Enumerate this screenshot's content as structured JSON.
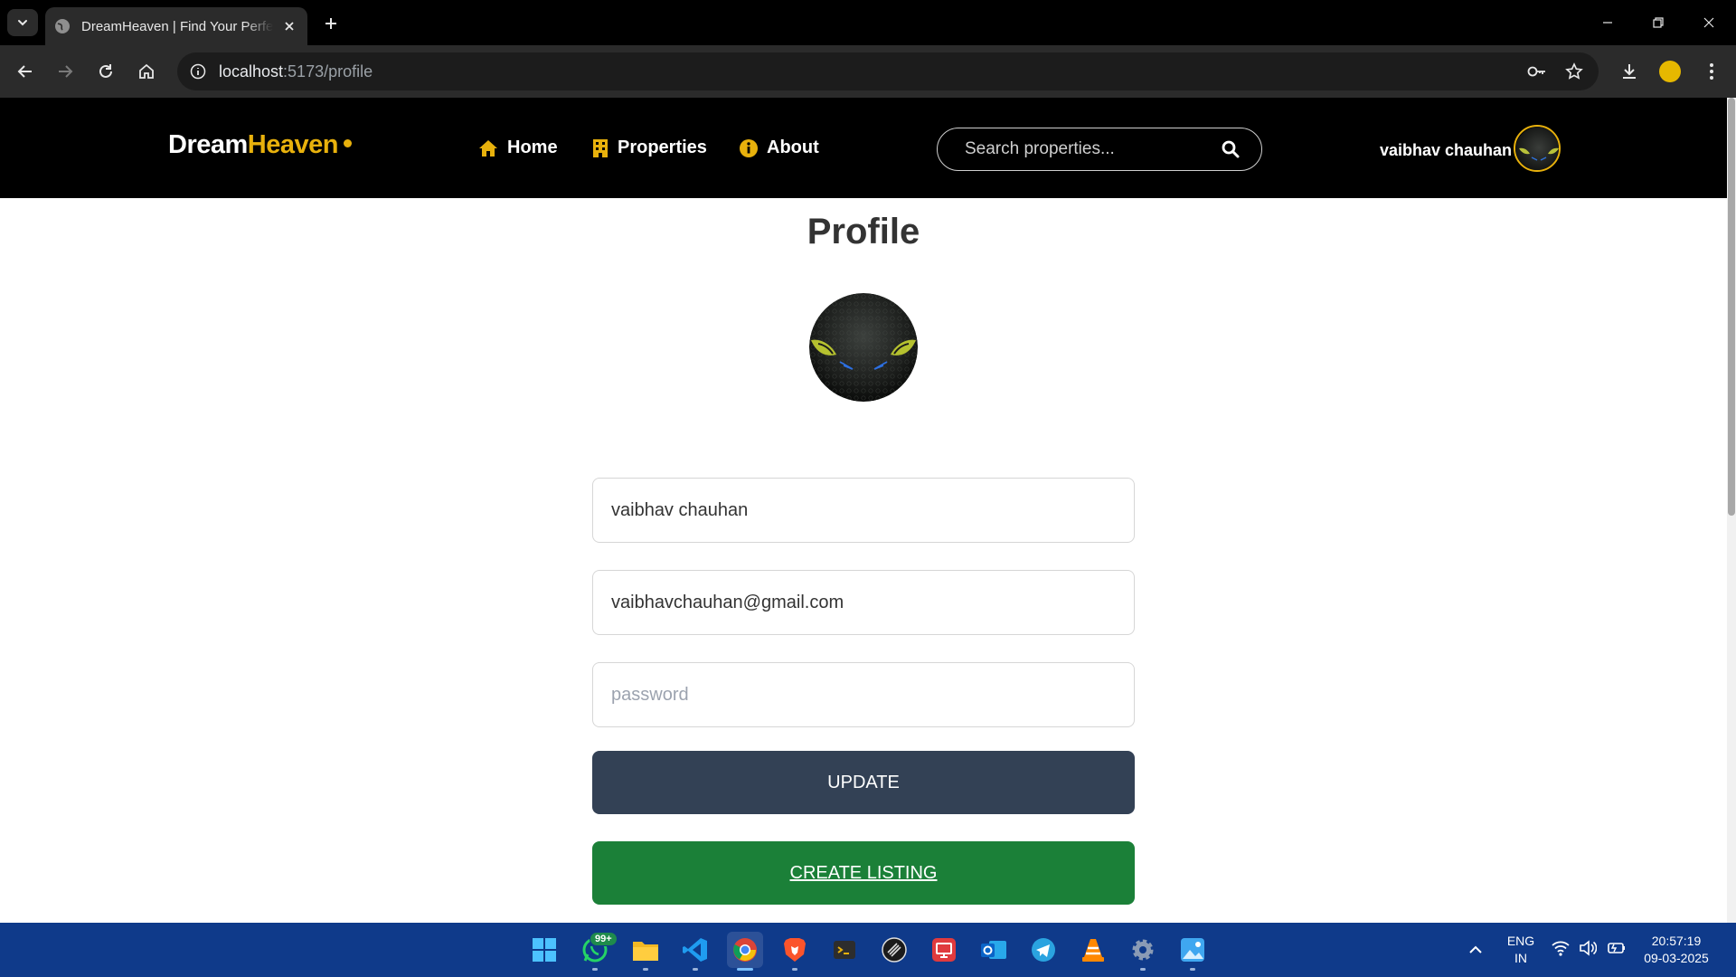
{
  "browser": {
    "tab_title": "DreamHeaven | Find Your Perfect",
    "url_host": "localhost",
    "url_path": ":5173/profile"
  },
  "site": {
    "logo_primary": "Dream",
    "logo_accent": "Heaven",
    "nav": [
      {
        "label": "Home",
        "icon": "home-icon"
      },
      {
        "label": "Properties",
        "icon": "building-icon"
      },
      {
        "label": "About",
        "icon": "info-icon"
      }
    ],
    "search_placeholder": "Search properties...",
    "username": "vaibhav chauhan"
  },
  "profile": {
    "title": "Profile",
    "name_value": "vaibhav chauhan",
    "email_value": "vaibhavchauhan@gmail.com",
    "password_placeholder": "password",
    "update_label": "UPDATE",
    "create_label": "CREATE LISTING"
  },
  "taskbar": {
    "whatsapp_badge": "99+",
    "lang_primary": "ENG",
    "lang_secondary": "IN",
    "time": "20:57:19",
    "date": "09-03-2025"
  },
  "colors": {
    "accent": "#e8b10c",
    "update_button": "#334155",
    "create_button": "#1b8038",
    "header_bg": "#000000"
  }
}
